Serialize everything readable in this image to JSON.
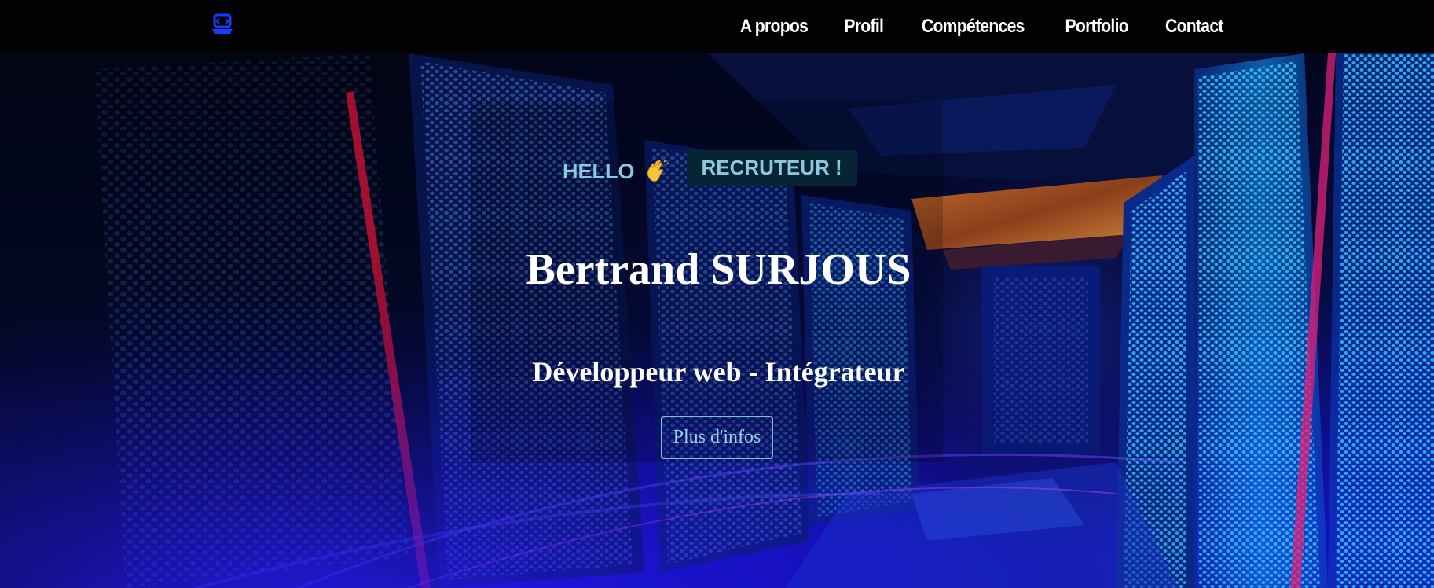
{
  "nav": {
    "logo_icon": "laptop-code-icon",
    "links": [
      {
        "label": "A propos"
      },
      {
        "label": "Profil"
      },
      {
        "label": "Compétences"
      },
      {
        "label": "Portfolio"
      },
      {
        "label": "Contact"
      }
    ]
  },
  "hero": {
    "background": "server-room-photo",
    "hello": "HELLO",
    "wave_icon": "waving-hand-icon",
    "badge": "RECRUTEUR !",
    "name": "Bertrand SURJOUS",
    "subtitle": "Développeur web - Intégrateur",
    "cta_label": "Plus d'infos"
  },
  "colors": {
    "nav_background": "#020202",
    "accent_text": "#8ec8dd",
    "badge_background": "#062433",
    "button_border": "#7ec0d8",
    "logo": "#1a3cff"
  }
}
